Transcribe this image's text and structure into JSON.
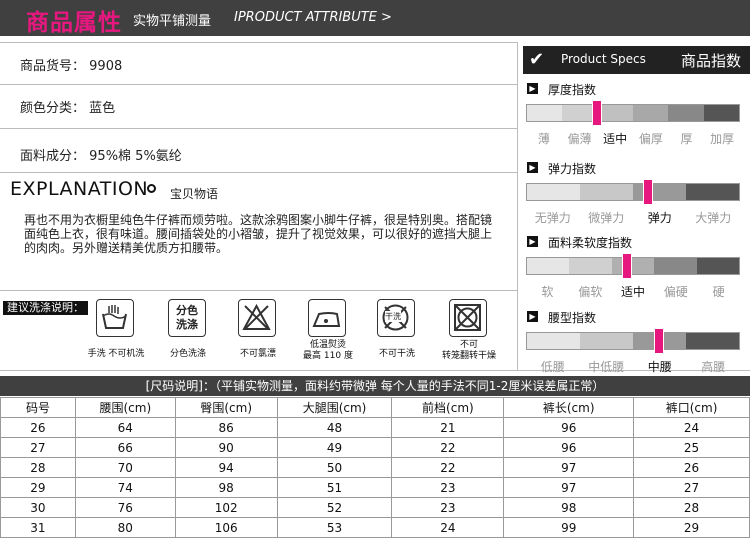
{
  "header": {
    "title_cn": "商品属性",
    "subtitle_cn": "实物平铺测量",
    "subtitle_en": "IPRODUCT ATTRIBUTE >"
  },
  "info": {
    "item_no_label": "商品货号：",
    "item_no_value": "9908",
    "color_label": "颜色分类：",
    "color_value": "蓝色",
    "fabric_label": "面料成分：",
    "fabric_value": "95%棉  5%氨纶"
  },
  "explanation": {
    "title": "EXPLANATION",
    "subtitle": "宝贝物语",
    "text": "再也不用为衣橱里纯色牛仔裤而烦劳啦。这款涂鸦图案小脚牛仔裤，很是特别奥。搭配镜面纯色上衣，很有味道。腰间插袋处的小褶皱，提升了视觉效果，可以很好的遮挡大腿上的肉肉。另外赠送精美优质方扣腰带。"
  },
  "wash": {
    "label": "建议洗涤说明：",
    "items": [
      {
        "icon": "hand-wash-icon",
        "caption": "手洗 不可机洗",
        "inner": ""
      },
      {
        "icon": "separate-wash-icon",
        "caption": "分色洗涤",
        "inner": "分色\n洗涤"
      },
      {
        "icon": "no-bleach-icon",
        "caption": "不可氯漂",
        "inner": ""
      },
      {
        "icon": "low-iron-icon",
        "caption": "低温熨烫\n最高 110 度",
        "inner": ""
      },
      {
        "icon": "no-dry-clean-icon",
        "caption": "不可干洗",
        "inner": "干洗"
      },
      {
        "icon": "no-tumble-dry-icon",
        "caption": "不可\n转笼翻转干燥",
        "inner": ""
      }
    ]
  },
  "specs": {
    "head_en": "Product Specs",
    "head_cn": "商品指数",
    "indices": [
      {
        "title": "厚度指数",
        "labels": [
          "薄",
          "偏薄",
          "适中",
          "偏厚",
          "厚",
          "加厚"
        ],
        "selected": 2,
        "level": 0.33,
        "shades": [
          "#e6e6e6",
          "#d0d0d0",
          "#c0c0c0",
          "#a8a8a8",
          "#888",
          "#555"
        ]
      },
      {
        "title": "弹力指数",
        "labels": [
          "无弹力",
          "微弹力",
          "弹力",
          "大弹力"
        ],
        "selected": 2,
        "level": 0.57,
        "shades": [
          "#e6e6e6",
          "#c8c8c8",
          "#999",
          "#555"
        ]
      },
      {
        "title": "面料柔软度指数",
        "labels": [
          "软",
          "偏软",
          "适中",
          "偏硬",
          "硬"
        ],
        "selected": 2,
        "level": 0.47,
        "shades": [
          "#e6e6e6",
          "#d0d0d0",
          "#b0b0b0",
          "#888",
          "#555"
        ]
      },
      {
        "title": "腰型指数",
        "labels": [
          "低腰",
          "中低腰",
          "中腰",
          "高腰"
        ],
        "selected": 2,
        "level": 0.62,
        "shades": [
          "#e6e6e6",
          "#c8c8c8",
          "#999",
          "#555"
        ]
      }
    ]
  },
  "size_table": {
    "caption": "[尺码说明]：（平铺实物测量，面料约带微弹 每个人量的手法不同1-2厘米误差属正常）",
    "headers": [
      "码号",
      "腰围(cm)",
      "臀围(cm)",
      "大腿围(cm)",
      "前档(cm)",
      "裤长(cm)",
      "裤口(cm)"
    ],
    "rows": [
      [
        "26",
        "64",
        "86",
        "48",
        "21",
        "96",
        "24"
      ],
      [
        "27",
        "66",
        "90",
        "49",
        "22",
        "96",
        "25"
      ],
      [
        "28",
        "70",
        "94",
        "50",
        "22",
        "97",
        "26"
      ],
      [
        "29",
        "74",
        "98",
        "51",
        "23",
        "97",
        "27"
      ],
      [
        "30",
        "76",
        "102",
        "52",
        "23",
        "98",
        "28"
      ],
      [
        "31",
        "80",
        "106",
        "53",
        "24",
        "99",
        "29"
      ]
    ]
  },
  "colors": {
    "accent": "#e6187f",
    "header_bg": "#404040"
  }
}
